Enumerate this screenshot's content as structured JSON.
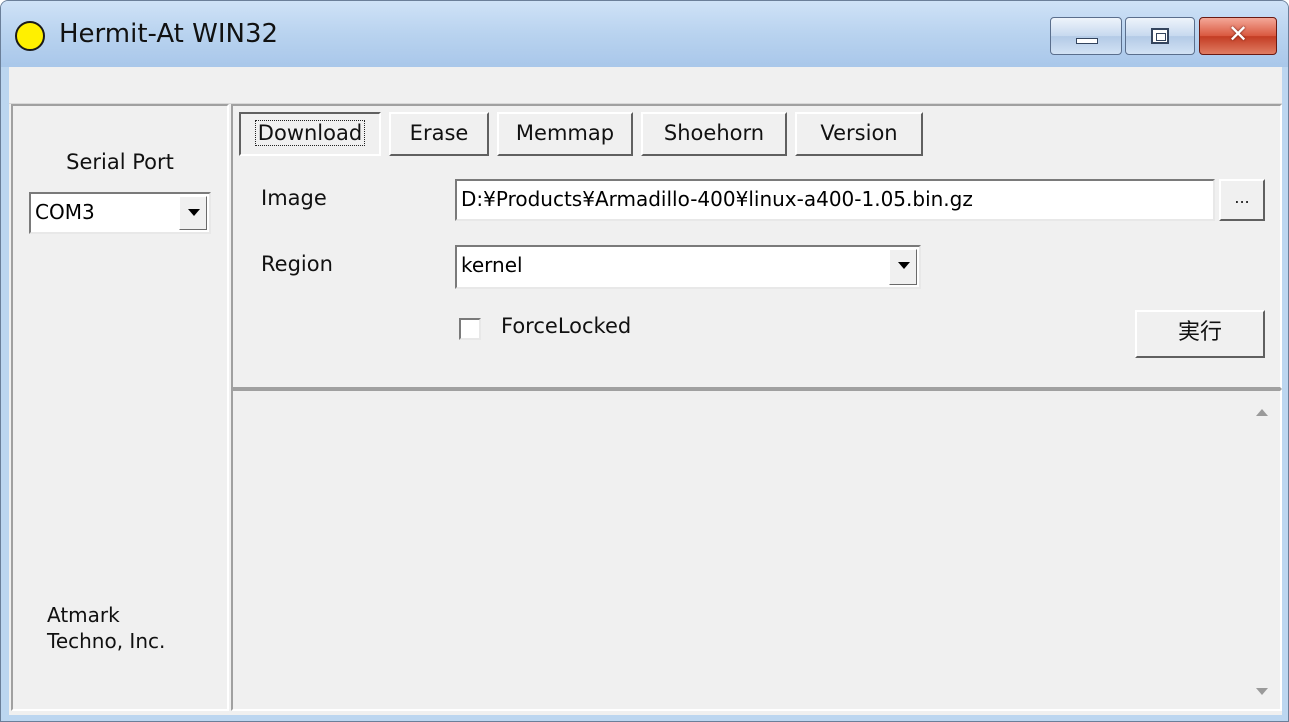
{
  "window": {
    "title": "Hermit-At WIN32",
    "icon": "yellow-circle-icon",
    "close_glyph": "✕"
  },
  "sidebar": {
    "serial_port_label": "Serial Port",
    "serial_port_value": "COM3",
    "company_line1": "Atmark",
    "company_line2": "Techno, Inc."
  },
  "tabs": [
    {
      "label": "Download",
      "active": true
    },
    {
      "label": "Erase",
      "active": false
    },
    {
      "label": "Memmap",
      "active": false
    },
    {
      "label": "Shoehorn",
      "active": false
    },
    {
      "label": "Version",
      "active": false
    }
  ],
  "download": {
    "image_label": "Image",
    "image_value": "D:¥Products¥Armadillo-400¥linux-a400-1.05.bin.gz",
    "browse_label": "...",
    "region_label": "Region",
    "region_value": "kernel",
    "force_locked_label": "ForceLocked",
    "force_locked_checked": false,
    "execute_label": "実行"
  },
  "colors": {
    "titlebar": "#b9d3ef",
    "face": "#f0f0f0",
    "close_button": "#c33c23",
    "status_light": "#fff000"
  }
}
